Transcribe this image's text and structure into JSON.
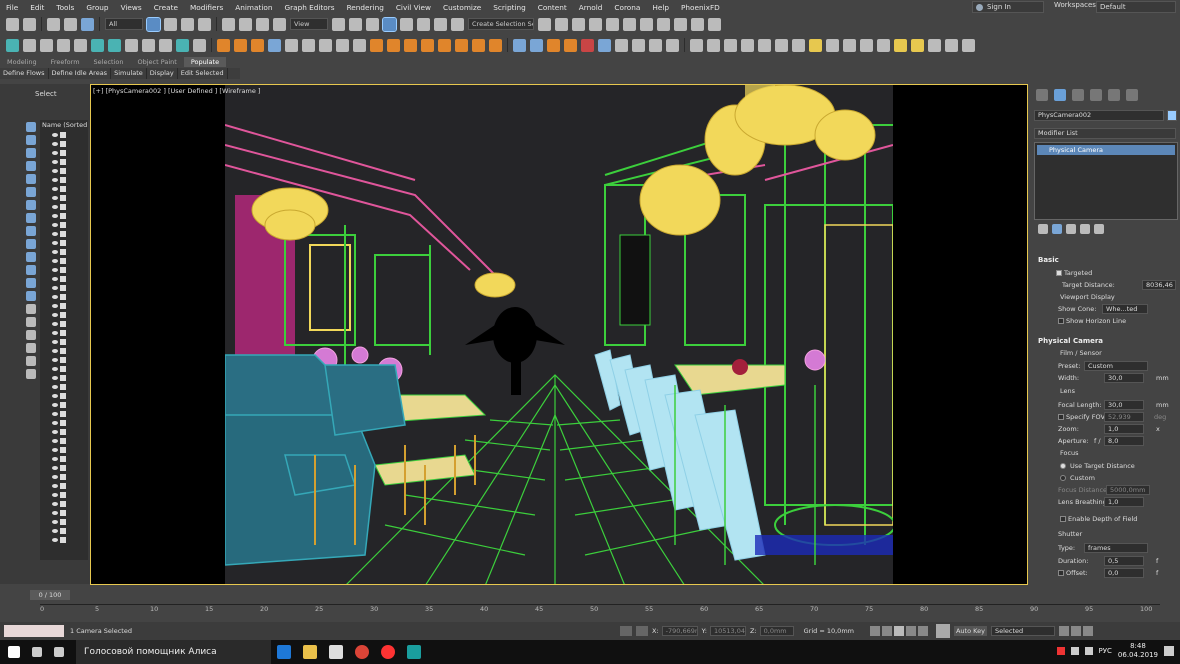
{
  "menu": [
    "File",
    "Edit",
    "Tools",
    "Group",
    "Views",
    "Create",
    "Modifiers",
    "Animation",
    "Graph Editors",
    "Rendering",
    "Civil View",
    "Customize",
    "Scripting",
    "Content",
    "Arnold",
    "Corona",
    "Help",
    "PhoenixFD"
  ],
  "account": {
    "signin": "Sign In",
    "workspaces_label": "Workspaces:",
    "workspace": "Default"
  },
  "toolbar": {
    "filter": "All",
    "ref_coord": "View",
    "selection_set": "Create Selection Se"
  },
  "ribbon": {
    "tabs": [
      "Modeling",
      "Freeform",
      "Selection",
      "Object Paint",
      "Populate"
    ],
    "active_tab": "Populate",
    "buttons": [
      "Define Flows",
      "Define Idle Areas",
      "Simulate",
      "Display",
      "Edit Selected"
    ]
  },
  "scene_explorer": {
    "select_label": "Select",
    "column": "Name (Sorted A"
  },
  "viewport": {
    "label": "[+] [PhysCamera002 ] [User Defined ] [Wireframe ]"
  },
  "command_panel": {
    "object_name": "PhysCamera002",
    "modifier_list": "Modifier List",
    "stack_item": "Physical Camera",
    "basic": {
      "title": "Basic",
      "targeted": "Targeted",
      "target_distance_label": "Target Distance:",
      "target_distance": "8036,46",
      "viewport_display": "Viewport Display",
      "show_cone_label": "Show Cone:",
      "show_cone": "Whe...ted",
      "show_horizon": "Show Horizon Line"
    },
    "physical_camera": {
      "title": "Physical Camera",
      "film_sensor": "Film / Sensor",
      "preset_label": "Preset:",
      "preset": "Custom",
      "width_label": "Width:",
      "width": "30,0",
      "width_unit": "mm",
      "lens": "Lens",
      "focal_length_label": "Focal Length:",
      "focal_length": "30,0",
      "focal_unit": "mm",
      "specify_fov": "Specify FOV:",
      "fov": "52,939",
      "fov_unit": "deg",
      "zoom_label": "Zoom:",
      "zoom": "1,0",
      "zoom_unit": "x",
      "aperture_label": "Aperture:",
      "aperture_prefix": "f /",
      "aperture": "8,0",
      "focus": "Focus",
      "use_target_distance": "Use Target Distance",
      "custom": "Custom",
      "focus_distance_label": "Focus Distance:",
      "focus_distance": "5000,0mm",
      "lens_breathing_label": "Lens Breathing:",
      "lens_breathing": "1,0",
      "enable_dof": "Enable Depth of Field",
      "shutter": "Shutter",
      "type_label": "Type:",
      "type": "frames",
      "duration_label": "Duration:",
      "duration": "0,5",
      "duration_unit": "f",
      "offset_label": "Offset:",
      "offset": "0,0",
      "offset_unit": "f"
    }
  },
  "timeline": {
    "frame": "0 / 100",
    "ticks": [
      "0",
      "5",
      "10",
      "15",
      "20",
      "25",
      "30",
      "35",
      "40",
      "45",
      "50",
      "55",
      "60",
      "65",
      "70",
      "75",
      "80",
      "85",
      "90",
      "95",
      "100"
    ]
  },
  "status": {
    "selection": "1 Camera Selected",
    "x_label": "X:",
    "x": "-790,669m",
    "y_label": "Y:",
    "y": "10513,043",
    "z_label": "Z:",
    "z": "0,0mm",
    "grid": "Grid = 10,0mm",
    "autokey": "Auto Key",
    "selected": "Selected"
  },
  "taskbar": {
    "assistant": "Голосовой помощник Алиса",
    "lang": "РУС",
    "time": "8:48",
    "date": "06.04.2019"
  },
  "colors": {
    "viewport_border": "#e7c84f",
    "selection_blue": "#5c87b8",
    "wire_green": "#3ccf3c",
    "wire_pink": "#e0569b",
    "wire_yellow": "#f2d85a",
    "wire_cyan": "#35a8b8"
  }
}
